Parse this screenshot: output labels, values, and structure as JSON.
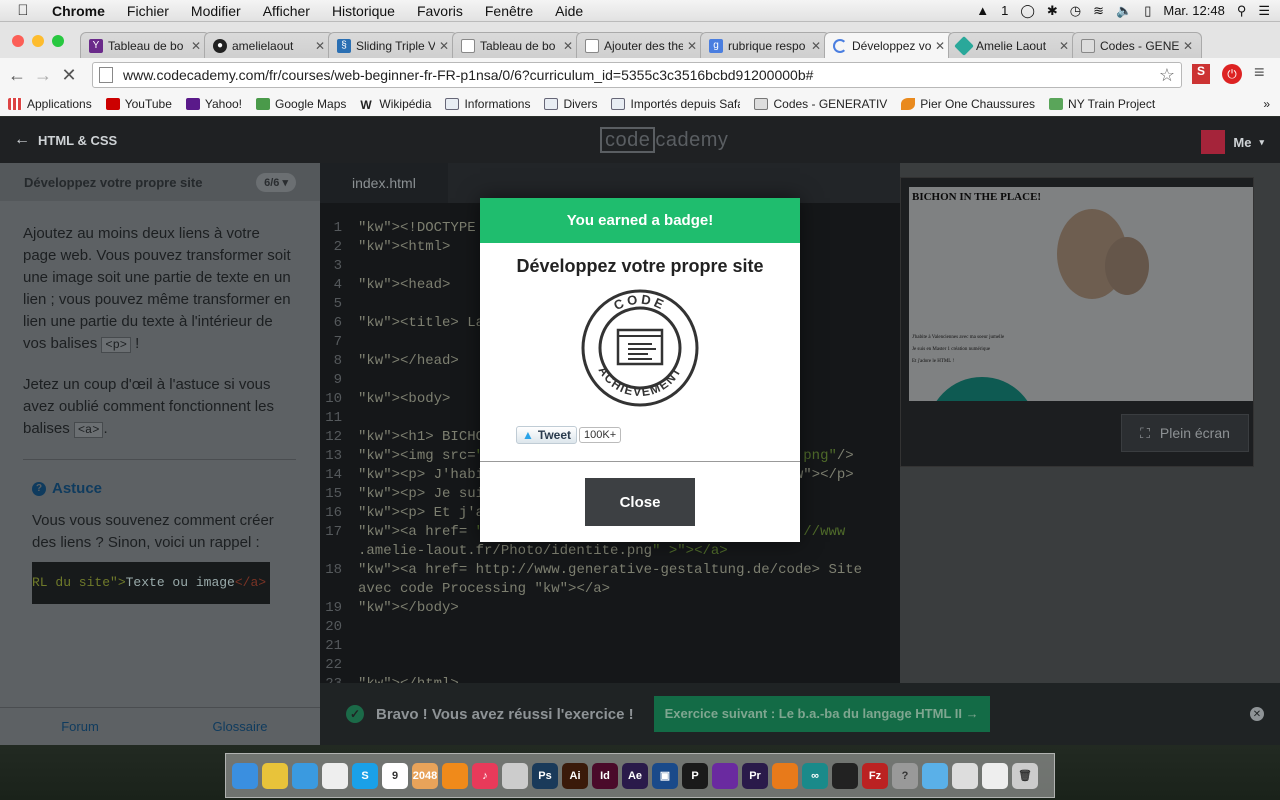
{
  "menubar": {
    "app": "Chrome",
    "items": [
      "Fichier",
      "Modifier",
      "Afficher",
      "Historique",
      "Favoris",
      "Fenêtre",
      "Aide"
    ],
    "clock": "Mar. 12:48",
    "status_num": "1"
  },
  "tabs": [
    {
      "label": "Tableau de bo",
      "icon": "yahoo-icon",
      "color": "#6a2a8a"
    },
    {
      "label": "amelielaout",
      "icon": "github-icon",
      "color": "#222"
    },
    {
      "label": "Sliding Triple V",
      "icon": "css-icon",
      "color": "#2a6fb3"
    },
    {
      "label": "Tableau de bo",
      "icon": "page-icon",
      "color": "#fff"
    },
    {
      "label": "Ajouter des the",
      "icon": "page-icon",
      "color": "#fff"
    },
    {
      "label": "rubrique respo",
      "icon": "google-icon",
      "color": "#4a7ee0"
    },
    {
      "label": "Développez vo",
      "icon": "loading-icon",
      "color": "#fff"
    },
    {
      "label": "Amelie Laout",
      "icon": "diamond-icon",
      "color": "#2aa89a"
    },
    {
      "label": "Codes - GENE",
      "icon": "codes-icon",
      "color": "#ddd"
    }
  ],
  "toolbar": {
    "url": "www.codecademy.com/fr/courses/web-beginner-fr-FR-p1nsa/0/6?curriculum_id=5355c3c3516bcbd91200000b#"
  },
  "bookmarks": [
    {
      "label": "Applications",
      "color": "#d44"
    },
    {
      "label": "YouTube",
      "color": "#c00"
    },
    {
      "label": "Yahoo!",
      "color": "#5a1a8a"
    },
    {
      "label": "Google Maps",
      "color": "#4a9a4a"
    },
    {
      "label": "Wikipédia",
      "color": "#eee"
    },
    {
      "label": "Informations",
      "color": "#7a8ea8"
    },
    {
      "label": "Divers",
      "color": "#7a8ea8"
    },
    {
      "label": "Importés depuis Safa",
      "color": "#7a8ea8"
    },
    {
      "label": "Codes - GENERATIV",
      "color": "#aaa"
    },
    {
      "label": "Pier One Chaussures",
      "color": "#e98a1e"
    },
    {
      "label": "NY Train Project",
      "color": "#5aa55a"
    }
  ],
  "cc": {
    "back_label": "HTML & CSS",
    "logo_left": "code",
    "logo_right": "cademy",
    "me": "Me",
    "lesson_title": "Développez votre propre site",
    "pager": "6/6",
    "p1_a": "Ajoutez au moins deux liens à votre page web. Vous pouvez transformer soit une image soit une partie de texte en un lien ; vous pouvez même transformer en lien une partie du texte à l'intérieur de vos balises ",
    "p1_code": "<p>",
    "p1_b": " !",
    "p2_a": "Jetez un coup d'œil à l'astuce si vous avez oublié comment fonctionnent les balises ",
    "p2_code": "<a>",
    "p2_b": ".",
    "astuce_title": "Astuce",
    "astuce_text": "Vous vous souvenez comment créer des liens ? Sinon, voici un rappel :",
    "astuce_code_str": "RL du site\">",
    "astuce_code_text": "Texte ou image",
    "astuce_code_tag": "</a>",
    "forum": "Forum",
    "glossaire": "Glossaire",
    "file_tab": "index.html",
    "preview_title": "BICHON IN THE PLACE!",
    "preview_line1": "J'habite à Valenciennes avec ma soeur jumelle",
    "preview_line2": "Je suis en Master 1 création numérique",
    "preview_line3": "Et j'adore le HTML !",
    "fullscreen": "Plein écran",
    "bravo": "Bravo ! Vous avez réussi l'exercice !",
    "next": "Exercice suivant : Le b.a.-ba du langage HTML II →"
  },
  "code_lines": [
    {
      "n": "1",
      "t": "<!DOCTYPE htm"
    },
    {
      "n": "2",
      "t": "<html>"
    },
    {
      "n": "3",
      "t": ""
    },
    {
      "n": "4",
      "t": "<head>"
    },
    {
      "n": "5",
      "t": ""
    },
    {
      "n": "6",
      "t": "<title> La pa"
    },
    {
      "n": "7",
      "t": ""
    },
    {
      "n": "8",
      "t": "</head>"
    },
    {
      "n": "9",
      "t": ""
    },
    {
      "n": "10",
      "t": "<body>"
    },
    {
      "n": "11",
      "t": ""
    },
    {
      "n": "12",
      "t": "<h1> BICHON I"
    },
    {
      "n": "13",
      "t": "<img src=\" ht                                  .png\"/>"
    },
    {
      "n": "14",
      "t": "<p> J'habite                                 </p>"
    },
    {
      "n": "15",
      "t": "<p> Je suis e"
    },
    {
      "n": "16",
      "t": "<p> Et j'ador"
    },
    {
      "n": "17",
      "t": "<a href= \"ht                                 tp://www"
    },
    {
      "n": "",
      "t": ".amelie-laout.fr/Photo/identite.png\" ></a>"
    },
    {
      "n": "18",
      "t": "<a href= http://www.generative-gestaltung.de/code> Site"
    },
    {
      "n": "",
      "t": "avec code Processing </a>"
    },
    {
      "n": "19",
      "t": "</body>"
    },
    {
      "n": "20",
      "t": ""
    },
    {
      "n": "21",
      "t": ""
    },
    {
      "n": "22",
      "t": ""
    },
    {
      "n": "23",
      "t": "</html>"
    }
  ],
  "modal": {
    "header": "You earned a badge!",
    "title": "Développez votre propre site",
    "badge_top": "CODE",
    "badge_bottom": "ACHIEVEMENT",
    "tweet": "Tweet",
    "count": "100K+",
    "close": "Close"
  },
  "dock": [
    "Finder",
    "Chrome",
    "Safari",
    "Notes",
    "Skype",
    "Calendar",
    "2048",
    "VLC",
    "iTunes",
    "Files",
    "Ps",
    "Ai",
    "Id",
    "Ae",
    "Box",
    "P",
    "Sound",
    "Pr",
    "Blender",
    "Arduino",
    "GitHub",
    "FileZilla",
    "Help",
    "Apps",
    "Photos",
    "Mail",
    "Trash"
  ],
  "colors": {
    "accent_green": "#1fbd6e",
    "button_dark": "#3d4043"
  }
}
